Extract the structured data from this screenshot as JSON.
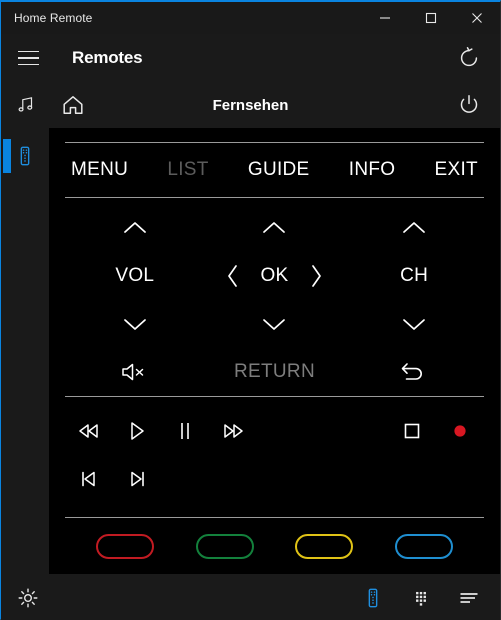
{
  "window": {
    "title": "Home Remote",
    "controls": [
      {
        "name": "minimize",
        "label": "—"
      },
      {
        "name": "maximize",
        "label": "□"
      },
      {
        "name": "close",
        "label": "✕"
      }
    ]
  },
  "appbar": {
    "menu_icon": "hamburger-icon",
    "title": "Remotes",
    "refresh_icon": "refresh-icon"
  },
  "devicebar": {
    "music_icon": "music-note-icon",
    "home_icon": "home-icon",
    "title": "Fernsehen",
    "power_icon": "power-icon"
  },
  "sidebar": {
    "items": [
      {
        "name": "sidebar-item-remotes",
        "icon": "remote-icon",
        "selected": true
      }
    ]
  },
  "remote": {
    "menu_row": [
      {
        "label": "MENU",
        "disabled": false
      },
      {
        "label": "LIST",
        "disabled": true
      },
      {
        "label": "GUIDE",
        "disabled": false
      },
      {
        "label": "INFO",
        "disabled": false
      },
      {
        "label": "EXIT",
        "disabled": false
      }
    ],
    "pad": {
      "vol_label": "VOL",
      "vol_up_icon": "chevron-up-icon",
      "vol_down_icon": "chevron-down-icon",
      "nav_up_icon": "chevron-up-icon",
      "nav_down_icon": "chevron-down-icon",
      "nav_left_icon": "chevron-left-icon",
      "nav_right_icon": "chevron-right-icon",
      "ok_label": "OK",
      "ch_label": "CH",
      "ch_up_icon": "chevron-up-icon",
      "ch_down_icon": "chevron-down-icon"
    },
    "return_row": {
      "mute_icon": "mute-icon",
      "return_label": "RETURN",
      "back_icon": "back-arrow-icon"
    },
    "transport": {
      "row1": [
        {
          "name": "rewind-button",
          "icon": "rewind-icon"
        },
        {
          "name": "play-button",
          "icon": "play-icon"
        },
        {
          "name": "pause-button",
          "icon": "pause-icon"
        },
        {
          "name": "fast-forward-button",
          "icon": "fast-forward-icon"
        }
      ],
      "row1_right": [
        {
          "name": "stop-button",
          "icon": "stop-icon"
        },
        {
          "name": "record-button",
          "icon": "record-icon",
          "color": "#d81722"
        }
      ],
      "row2": [
        {
          "name": "previous-track-button",
          "icon": "previous-track-icon"
        },
        {
          "name": "next-track-button",
          "icon": "next-track-icon"
        }
      ]
    },
    "color_buttons": [
      {
        "name": "color-button-red",
        "color": "#c21b22"
      },
      {
        "name": "color-button-green",
        "color": "#13813c"
      },
      {
        "name": "color-button-yellow",
        "color": "#e0c316"
      },
      {
        "name": "color-button-blue",
        "color": "#1f8fd1"
      }
    ]
  },
  "bottombar": {
    "settings_icon": "gear-icon",
    "items": [
      {
        "name": "nav-remote",
        "icon": "remote-icon",
        "active": true
      },
      {
        "name": "nav-keypad",
        "icon": "keypad-icon",
        "active": false
      },
      {
        "name": "nav-list",
        "icon": "list-icon",
        "active": false
      }
    ]
  },
  "colors": {
    "accent": "#0a84e0",
    "window_bg": "#1a1a1a",
    "panel_bg": "#000000",
    "text": "#ffffff",
    "text_dim": "#5c5c5c",
    "divider": "#9a9a9a"
  }
}
